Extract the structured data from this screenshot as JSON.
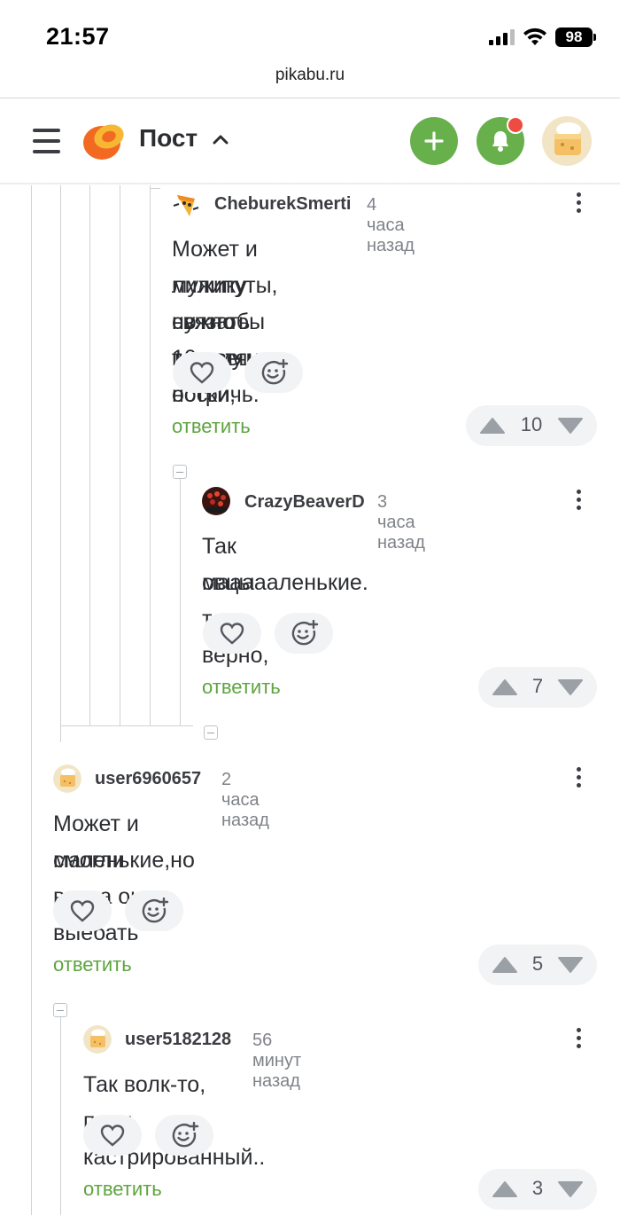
{
  "status_bar": {
    "time": "21:57",
    "battery": "98"
  },
  "browser": {
    "url": "pikabu.ru"
  },
  "header": {
    "title": "Пост"
  },
  "comments": [
    {
      "username": "CheburekSmerti",
      "time": "4 часа назад",
      "text_lines": [
        "Может и лилипуты, но чтобы такому",
        "мужику связать шерстяные носки,",
        "нужно 10 овец остричь."
      ],
      "reply_label": "ответить",
      "rating": "10"
    },
    {
      "username": "CrazyBeaverD",
      "time": "3 часа назад",
      "text_lines": [
        "Так овцы то верно,",
        "маааааленькие."
      ],
      "reply_label": "ответить",
      "rating": "7"
    },
    {
      "username": "user6960657",
      "time": "2 часа назад",
      "text_lines": [
        "Может и маленькие,но волка они выебать",
        "смогли"
      ],
      "reply_label": "ответить",
      "rating": "5"
    },
    {
      "username": "user5182128",
      "time": "56 минут назад",
      "text_lines": [
        "Так волк-то, поди, кастрированный.."
      ],
      "reply_label": "ответить",
      "rating": "3"
    }
  ],
  "icons": [
    "menu-icon",
    "pikabu-logo",
    "chevron-up-icon",
    "plus-icon",
    "bell-icon",
    "heart-icon",
    "add-reaction-icon",
    "upvote-icon",
    "downvote-icon",
    "more-icon"
  ],
  "colors": {
    "accent": "#68b04c",
    "reply": "#5ea43f",
    "notification": "#ee4c40"
  }
}
